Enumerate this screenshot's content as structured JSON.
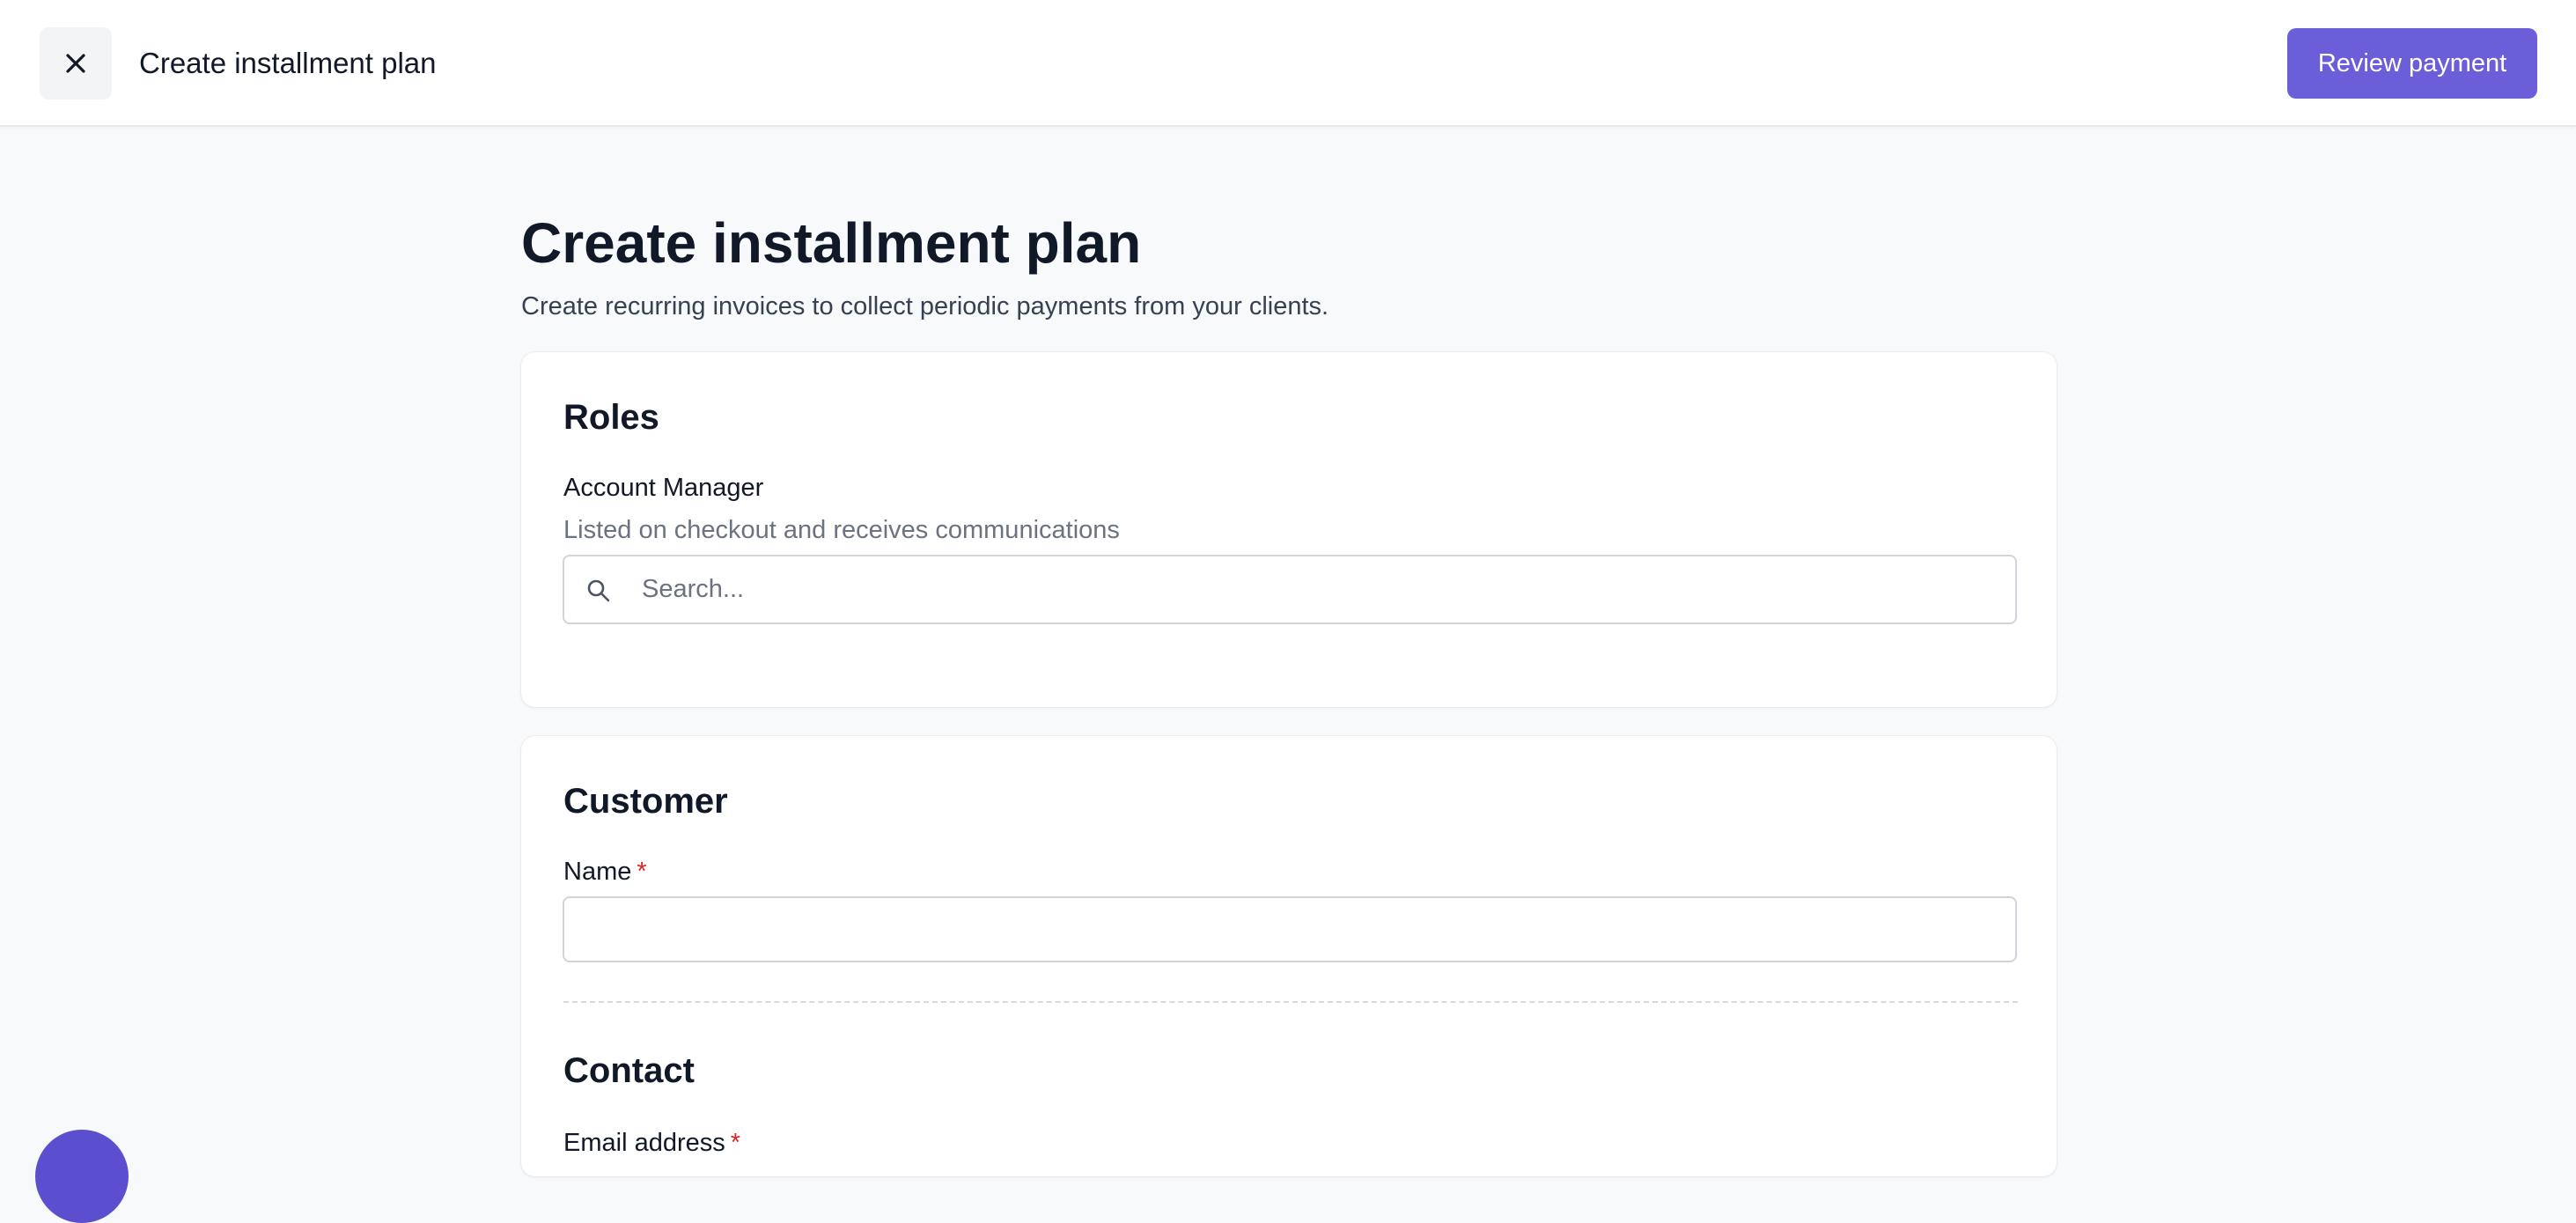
{
  "topbar": {
    "close_icon": "close-icon",
    "title": "Create installment plan",
    "review_label": "Review payment"
  },
  "page": {
    "title": "Create installment plan",
    "subtitle": "Create recurring invoices to collect periodic payments from your clients."
  },
  "roles": {
    "heading": "Roles",
    "account_manager": {
      "label": "Account Manager",
      "help": "Listed on checkout and receives communications",
      "placeholder": "Search...",
      "icon": "search-icon"
    }
  },
  "customer": {
    "heading": "Customer",
    "name_label": "Name",
    "required_mark": "*",
    "name_value": ""
  },
  "contact": {
    "heading": "Contact",
    "email_label": "Email address",
    "required_mark": "*"
  },
  "colors": {
    "accent": "#6a5fd9",
    "required": "#dc2626",
    "background": "#f8f9fb"
  }
}
